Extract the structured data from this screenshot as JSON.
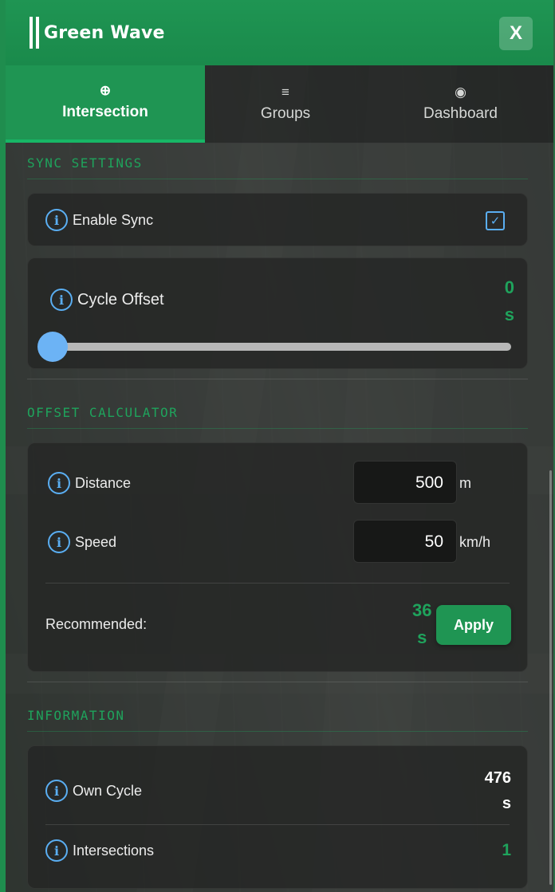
{
  "app": {
    "title": "Green Wave",
    "close_label": "X"
  },
  "tabs": [
    {
      "label": "Intersection",
      "icon": "⊕"
    },
    {
      "label": "Groups",
      "icon": "≡"
    },
    {
      "label": "Dashboard",
      "icon": "◉"
    }
  ],
  "sync": {
    "heading": "SYNC SETTINGS",
    "enable_label": "Enable Sync",
    "enable_checked": true,
    "cycle_offset_label": "Cycle Offset",
    "cycle_offset_value": "0",
    "cycle_offset_unit": "s",
    "slider_fraction": 0
  },
  "calculator": {
    "heading": "OFFSET CALCULATOR",
    "distance_label": "Distance",
    "distance_value": "500",
    "distance_unit": "m",
    "speed_label": "Speed",
    "speed_value": "50",
    "speed_unit": "km/h",
    "recommended_label": "Recommended:",
    "recommended_value": "36",
    "recommended_unit": "s",
    "apply_label": "Apply"
  },
  "information": {
    "heading": "INFORMATION",
    "own_cycle_label": "Own Cycle",
    "own_cycle_value": "476",
    "own_cycle_unit": "s",
    "intersections_label": "Intersections",
    "intersections_value": "1"
  },
  "colors": {
    "accent": "#1f9553",
    "accent_text": "#1fa35c",
    "info_icon": "#5aaef2"
  }
}
